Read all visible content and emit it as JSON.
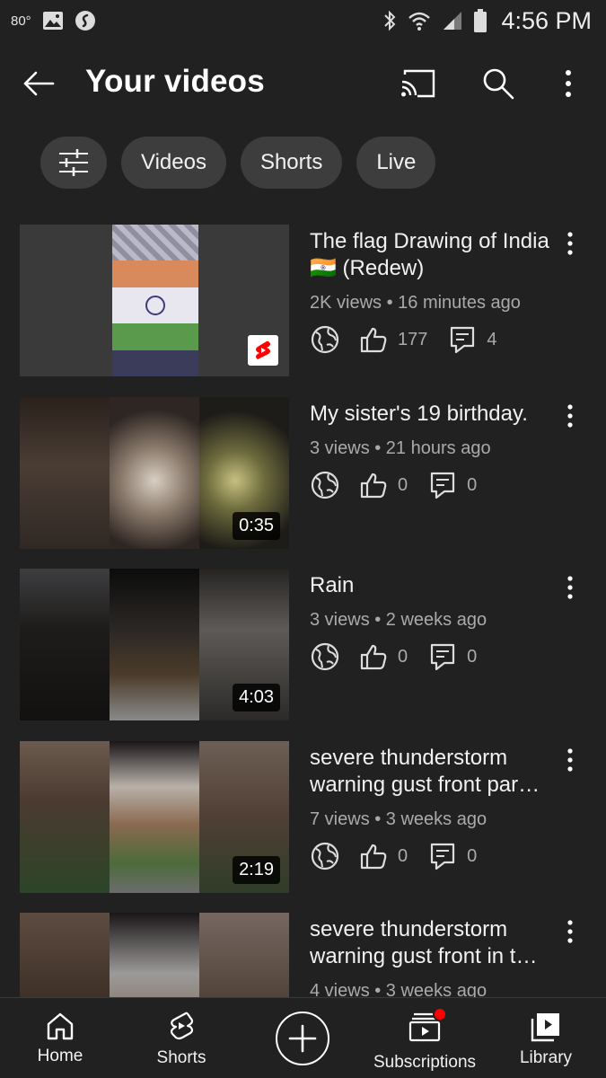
{
  "status_bar": {
    "temperature": "80°",
    "time": "4:56 PM"
  },
  "header": {
    "title": "Your videos"
  },
  "chips": [
    {
      "label": "Videos"
    },
    {
      "label": "Shorts"
    },
    {
      "label": "Live"
    }
  ],
  "videos": [
    {
      "title": "The flag Drawing of India 🇮🇳 (Redew)",
      "meta": "2K views • 16 minutes ago",
      "likes": "177",
      "comments": "4",
      "badge": "shorts",
      "duration": ""
    },
    {
      "title": "My sister's 19 birthday.",
      "meta": "3 views • 21 hours ago",
      "likes": "0",
      "comments": "0",
      "badge": "duration",
      "duration": "0:35"
    },
    {
      "title": "Rain",
      "meta": "3 views • 2 weeks ago",
      "likes": "0",
      "comments": "0",
      "badge": "duration",
      "duration": "4:03"
    },
    {
      "title": "severe thunderstorm warning gust front par…",
      "meta": "7 views • 3 weeks ago",
      "likes": "0",
      "comments": "0",
      "badge": "duration",
      "duration": "2:19"
    },
    {
      "title": "severe thunderstorm warning gust front in t…",
      "meta": "4 views • 3 weeks ago",
      "likes": "",
      "comments": "",
      "badge": "",
      "duration": ""
    }
  ],
  "bottom_nav": [
    {
      "label": "Home",
      "icon": "home-icon"
    },
    {
      "label": "Shorts",
      "icon": "shorts-icon"
    },
    {
      "label": "",
      "icon": "create-icon"
    },
    {
      "label": "Subscriptions",
      "icon": "subscriptions-icon"
    },
    {
      "label": "Library",
      "icon": "library-icon"
    }
  ],
  "colors": {
    "background": "#212121",
    "chip": "#3d3d3d",
    "secondary_text": "#aaaaaa",
    "accent_red": "#ff0000"
  }
}
